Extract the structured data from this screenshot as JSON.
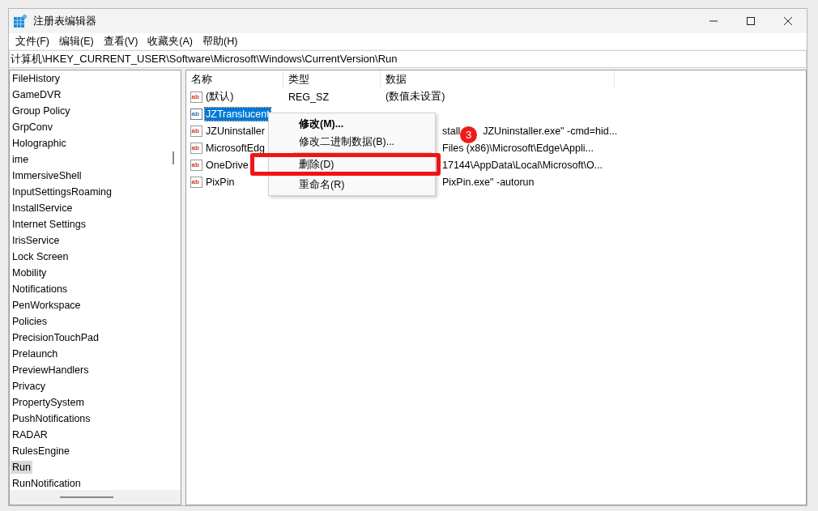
{
  "window": {
    "title": "注册表编辑器"
  },
  "menu_bar": [
    "文件(F)",
    "编辑(E)",
    "查看(V)",
    "收藏夹(A)",
    "帮助(H)"
  ],
  "address": "计算机\\HKEY_CURRENT_USER\\Software\\Microsoft\\Windows\\CurrentVersion\\Run",
  "tree": {
    "items": [
      {
        "label": "FileHistory",
        "selected": false
      },
      {
        "label": "GameDVR",
        "selected": false
      },
      {
        "label": "Group Policy",
        "selected": false
      },
      {
        "label": "GrpConv",
        "selected": false
      },
      {
        "label": "Holographic",
        "selected": false
      },
      {
        "label": "ime",
        "selected": false
      },
      {
        "label": "ImmersiveShell",
        "selected": false
      },
      {
        "label": "InputSettingsRoaming",
        "selected": false
      },
      {
        "label": "InstallService",
        "selected": false
      },
      {
        "label": "Internet Settings",
        "selected": false
      },
      {
        "label": "IrisService",
        "selected": false
      },
      {
        "label": "Lock Screen",
        "selected": false
      },
      {
        "label": "Mobility",
        "selected": false
      },
      {
        "label": "Notifications",
        "selected": false
      },
      {
        "label": "PenWorkspace",
        "selected": false
      },
      {
        "label": "Policies",
        "selected": false
      },
      {
        "label": "PrecisionTouchPad",
        "selected": false
      },
      {
        "label": "Prelaunch",
        "selected": false
      },
      {
        "label": "PreviewHandlers",
        "selected": false
      },
      {
        "label": "Privacy",
        "selected": false
      },
      {
        "label": "PropertySystem",
        "selected": false
      },
      {
        "label": "PushNotifications",
        "selected": false
      },
      {
        "label": "RADAR",
        "selected": false
      },
      {
        "label": "RulesEngine",
        "selected": false
      },
      {
        "label": "Run",
        "selected": true
      },
      {
        "label": "RunNotification",
        "selected": false
      }
    ]
  },
  "table": {
    "columns": [
      "名称",
      "类型",
      "数据"
    ],
    "rows": [
      {
        "icon_label": "ab",
        "name": "(默认)",
        "type": "REG_SZ",
        "data": [
          "(数值未设置)"
        ],
        "selected": false
      },
      {
        "icon_label": "ab",
        "name": "JZTranslucent",
        "selected": true
      },
      {
        "icon_label": "ab",
        "name": "JZUninstaller",
        "data": [
          "stall",
          "JZUninstaller.exe\" -cmd=hid..."
        ],
        "selected": false,
        "data_partial": true
      },
      {
        "icon_label": "ab",
        "name": "MicrosoftEdg",
        "data": [
          "Files (x86)\\Microsoft\\Edge\\Appli..."
        ],
        "selected": false,
        "data_partial": true
      },
      {
        "icon_label": "ab",
        "name": "OneDrive",
        "data": [
          "17144\\AppData\\Local\\Microsoft\\O..."
        ],
        "selected": false,
        "data_partial": true
      },
      {
        "icon_label": "ab",
        "name": "PixPin",
        "data": [
          "PixPin.exe\" -autorun"
        ],
        "selected": false,
        "data_partial": true
      }
    ]
  },
  "context_menu": [
    {
      "label": "修改(M)...",
      "kind": "default"
    },
    {
      "label": "修改二进制数据(B)...",
      "kind": "item",
      "highlighted": false
    },
    {
      "kind": "separator"
    },
    {
      "label": "删除(D)",
      "kind": "item",
      "highlighted": true
    },
    {
      "label": "重命名(R)",
      "kind": "item",
      "highlighted": false
    }
  ],
  "step_badge": "3"
}
